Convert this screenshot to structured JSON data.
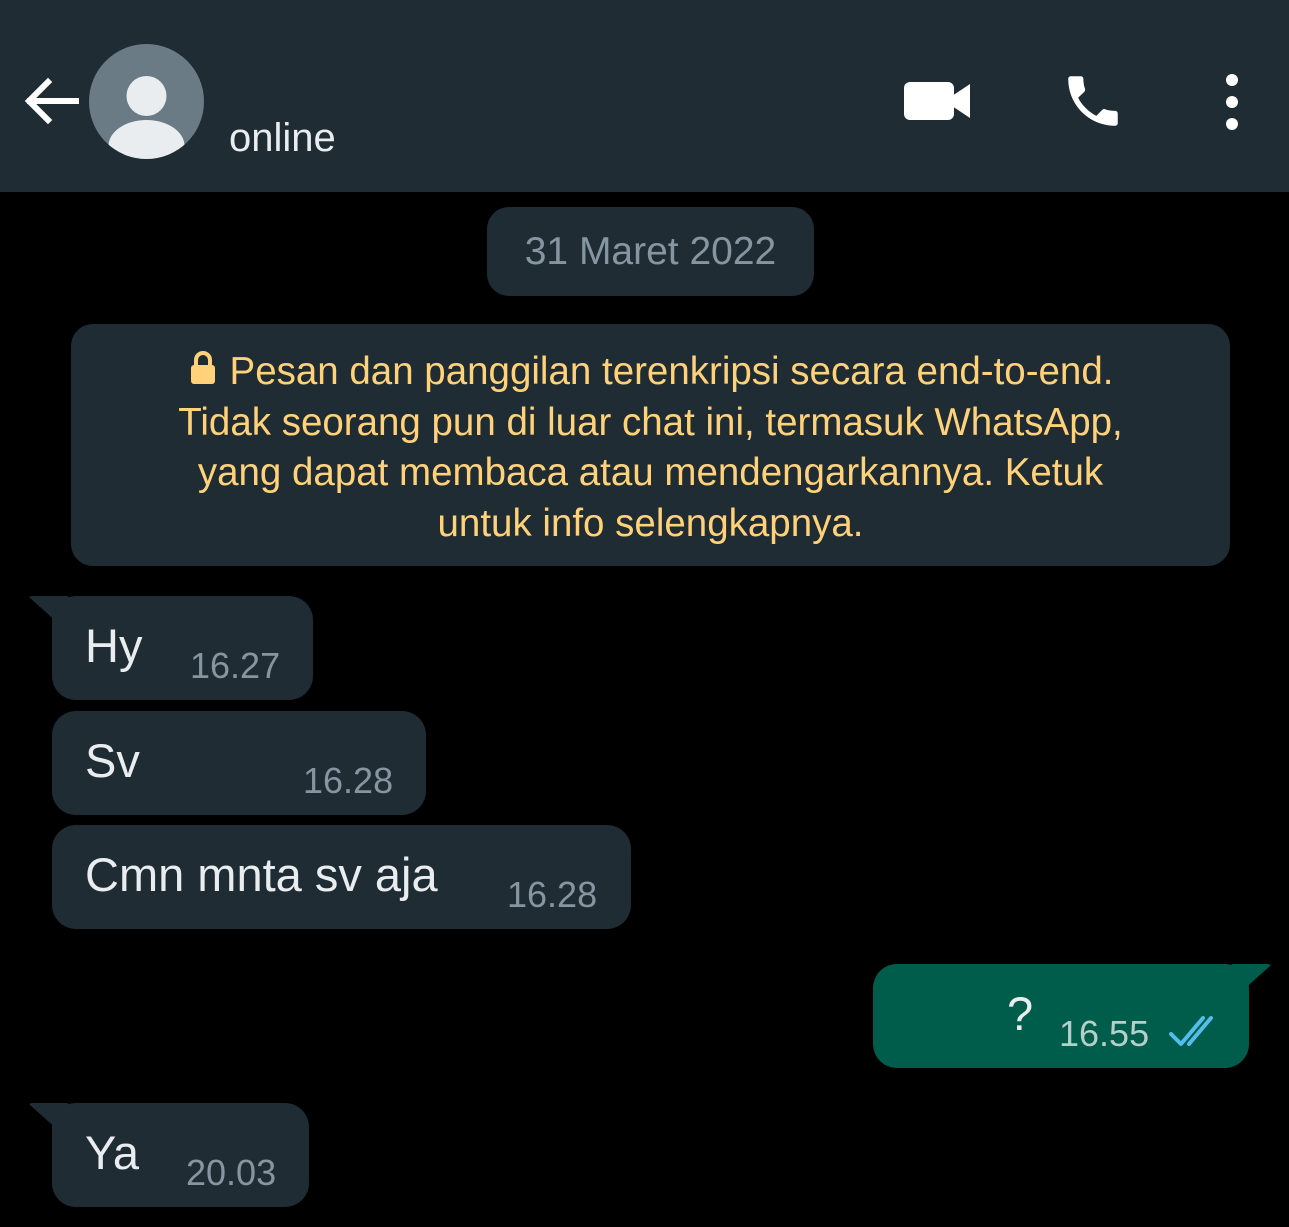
{
  "header": {
    "status": "online",
    "back_icon": "arrow-left-icon",
    "avatar_icon": "default-avatar-icon",
    "video_icon": "video-camera-icon",
    "call_icon": "phone-icon",
    "menu_icon": "more-vertical-icon"
  },
  "date_chip": "31 Maret 2022",
  "encryption_notice": {
    "icon": "lock-icon",
    "lines": [
      "Pesan dan panggilan terenkripsi secara end-to-end.",
      "Tidak seorang pun di luar chat ini, termasuk WhatsApp,",
      "yang dapat membaca atau mendengarkannya. Ketuk",
      "untuk info selengkapnya."
    ]
  },
  "messages": [
    {
      "direction": "incoming",
      "text": "Hy",
      "time": "16.27"
    },
    {
      "direction": "incoming",
      "text": "Sv",
      "time": "16.28"
    },
    {
      "direction": "incoming",
      "text": "Cmn mnta sv aja",
      "time": "16.28"
    },
    {
      "direction": "outgoing",
      "text": "?",
      "time": "16.55",
      "status": "read",
      "status_icon": "double-check-icon"
    },
    {
      "direction": "incoming",
      "text": "Ya",
      "time": "20.03"
    }
  ],
  "colors": {
    "header_bg": "#1f2c34",
    "chat_bg": "#000000",
    "incoming_bubble": "#1f2c34",
    "outgoing_bubble": "#005c4b",
    "notice_text": "#ffd279",
    "read_ticks": "#53bdeb"
  }
}
